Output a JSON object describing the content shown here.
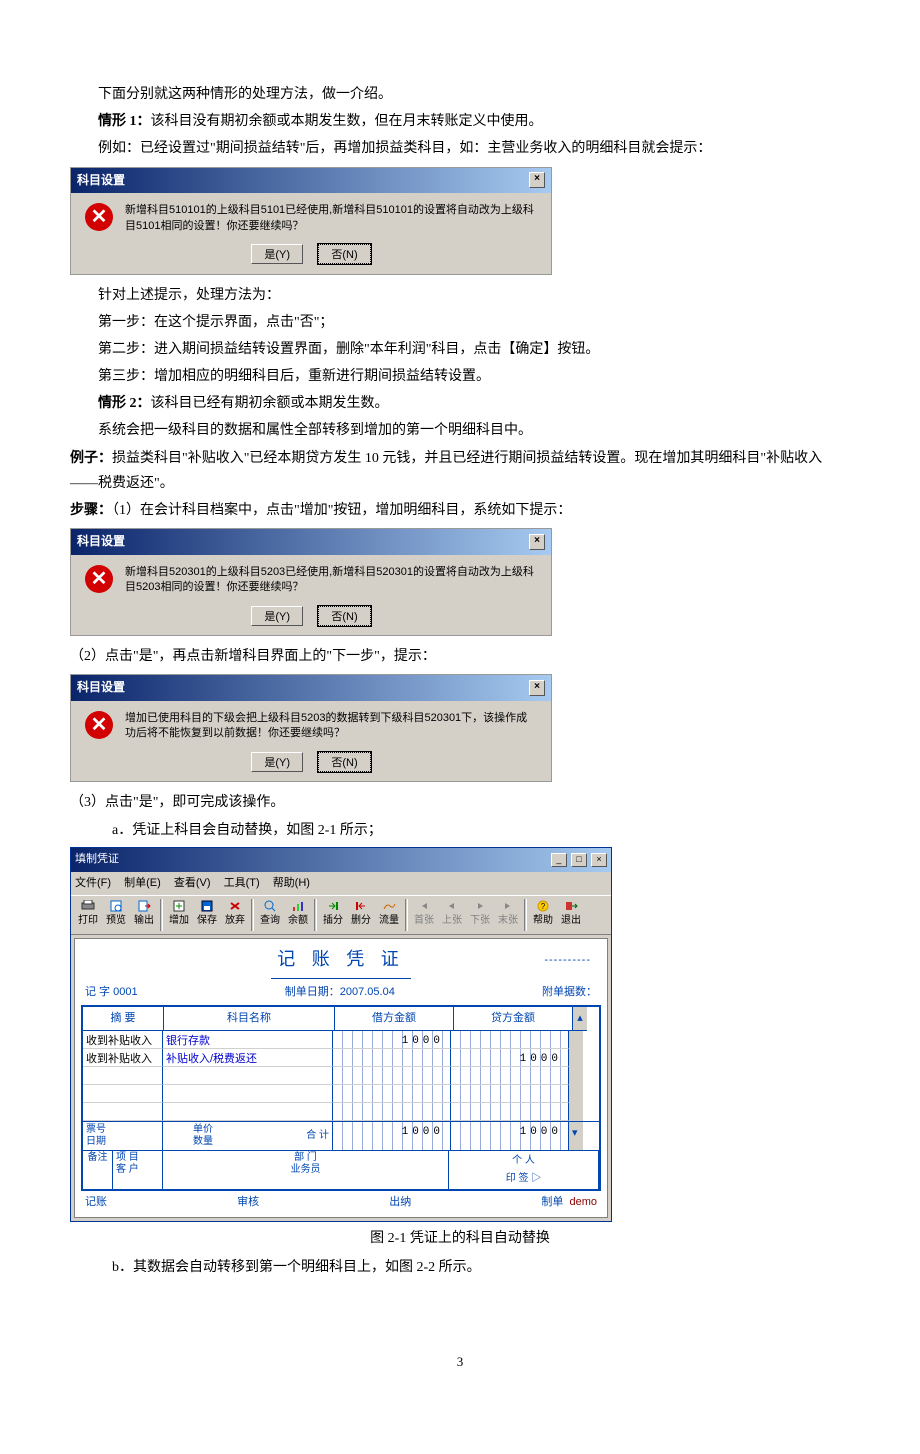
{
  "para_intro": "下面分别就这两种情形的处理方法，做一介绍。",
  "case1_label": "情形 1：",
  "case1_text": "该科目没有期初余额或本期发生数，但在月末转账定义中使用。",
  "case1_example": "例如：已经设置过\"期间损益结转\"后，再增加损益类科目，如：主营业务收入的明细科目就会提示：",
  "dlg1": {
    "title": "科目设置",
    "msg": "新增科目510101的上级科目5101已经使用,新增科目510101的设置将自动改为上级科目5101相同的设置！你还要继续吗？",
    "yes": "是(Y)",
    "no": "否(N)"
  },
  "resp_intro": "针对上述提示，处理方法为：",
  "step1": "第一步：在这个提示界面，点击\"否\"；",
  "step2": "第二步：进入期间损益结转设置界面，删除\"本年利润\"科目，点击【确定】按钮。",
  "step3": "第三步：增加相应的明细科目后，重新进行期间损益结转设置。",
  "case2_label": "情形 2：",
  "case2_text": "该科目已经有期初余额或本期发生数。",
  "case2_line": "系统会把一级科目的数据和属性全部转移到增加的第一个明细科目中。",
  "ex_label": "例子：",
  "ex_text": "损益类科目\"补贴收入\"已经本期贷方发生 10 元钱，并且已经进行期间损益结转设置。现在增加其明细科目\"补贴收入——税费返还\"。",
  "steps_label": "步骤：",
  "steps_text": "（1）在会计科目档案中，点击\"增加\"按钮，增加明细科目，系统如下提示：",
  "dlg2": {
    "title": "科目设置",
    "msg": "新增科目520301的上级科目5203已经使用,新增科目520301的设置将自动改为上级科目5203相同的设置！你还要继续吗？",
    "yes": "是(Y)",
    "no": "否(N)"
  },
  "step_2_line": "（2）点击\"是\"，再点击新增科目界面上的\"下一步\"，提示：",
  "dlg3": {
    "title": "科目设置",
    "msg": "增加已使用科目的下级会把上级科目5203的数据转到下级科目520301下，该操作成功后将不能恢复到以前数据！你还要继续吗？",
    "yes": "是(Y)",
    "no": "否(N)"
  },
  "step_3_line": "（3）点击\"是\"，即可完成该操作。",
  "sub_a": "a．凭证上科目会自动替换，如图 2-1 所示；",
  "voucher": {
    "wintitle": "填制凭证",
    "menus": [
      "文件(F)",
      "制单(E)",
      "查看(V)",
      "工具(T)",
      "帮助(H)"
    ],
    "toolbar": [
      "打印",
      "预览",
      "输出",
      "增加",
      "保存",
      "放弃",
      "查询",
      "余额",
      "插分",
      "删分",
      "流量",
      "首张",
      "上张",
      "下张",
      "末张",
      "帮助",
      "退出"
    ],
    "title": "记 账 凭 证",
    "left_meta": "记 字   0001",
    "mid_meta": "制单日期：2007.05.04",
    "right_meta": "附单据数：",
    "hdr": [
      "摘 要",
      "科目名称",
      "借方金额",
      "贷方金额"
    ],
    "rows": [
      {
        "sum": "收到补贴收入",
        "sub": "银行存款",
        "debit": "1000",
        "credit": ""
      },
      {
        "sum": "收到补贴收入",
        "sub": "补贴收入/税费返还",
        "debit": "",
        "credit": "1000"
      },
      {
        "sum": "",
        "sub": "",
        "debit": "",
        "credit": ""
      },
      {
        "sum": "",
        "sub": "",
        "debit": "",
        "credit": ""
      },
      {
        "sum": "",
        "sub": "",
        "debit": "",
        "credit": ""
      }
    ],
    "extra": {
      "l1": "票号",
      "l2": "日期",
      "c1": "单价",
      "c2": "数量",
      "sum": "合 计",
      "d": "1000",
      "c": "1000"
    },
    "foot": {
      "l1": "项 目",
      "l2": "客 户",
      "m1": "部 门",
      "m2": "业务员",
      "r": "个    人"
    },
    "status": {
      "l": "记账",
      "m": "审核",
      "r1": "出纳",
      "r2": "制单",
      "r3": "demo"
    }
  },
  "caption": "图 2-1    凭证上的科目自动替换",
  "sub_b": "b．其数据会自动转移到第一个明细科目上，如图 2-2 所示。",
  "page": "3"
}
